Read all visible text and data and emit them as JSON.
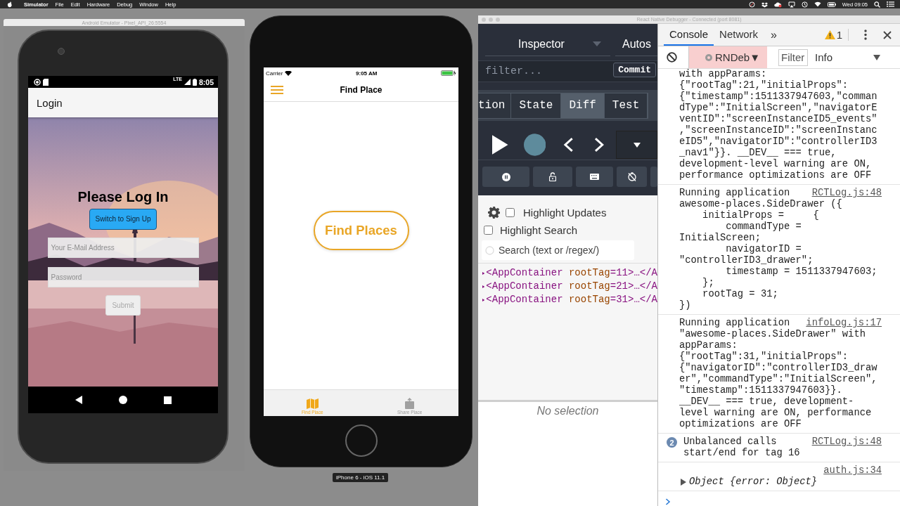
{
  "menu_bar": {
    "app_name": "Simulator",
    "menus": [
      "File",
      "Edit",
      "Hardware",
      "Debug",
      "Window",
      "Help"
    ],
    "clock": "Wed 09:05"
  },
  "android_emulator": {
    "window_title": "Android Emulator - Pixel_API_26:5554",
    "status_bar": {
      "network": "LTE",
      "time": "8:05"
    },
    "app_bar_title": "Login",
    "heading": "Please Log In",
    "switch_button": "Switch to Sign Up",
    "email_field": {
      "placeholder": "Your E-Mail Address"
    },
    "password_field": {
      "placeholder": "Password"
    },
    "submit": {
      "label": "Submit",
      "disabled": true
    }
  },
  "ios_simulator": {
    "status_bar": {
      "carrier": "Carrier",
      "time": "9:05 AM"
    },
    "nav_title": "Find Place",
    "find_places_button": "Find Places",
    "tabs": [
      {
        "label": "Find Place",
        "kind": "map",
        "selected": true
      },
      {
        "label": "Share Place",
        "kind": "share",
        "selected": false
      }
    ],
    "device_label": "iPhone 6 - iOS 11.1"
  },
  "debugger": {
    "window_title": "React Native Debugger - Connected (port 8081)",
    "redux": {
      "monitor": "Inspector",
      "second_monitor": "Autos",
      "filter_field": {
        "placeholder": "filter..."
      },
      "commit_button": "Commit",
      "tabs": [
        {
          "label": "tion",
          "selected": false
        },
        {
          "label": "State",
          "selected": false
        },
        {
          "label": "Diff",
          "selected": true
        },
        {
          "label": "Test",
          "selected": false
        }
      ]
    },
    "react": {
      "highlight_updates": {
        "label": "Highlight Updates",
        "checked": false
      },
      "highlight_search": {
        "label": "Highlight Search",
        "checked": false
      },
      "search_field": {
        "placeholder": "Search (text or /regex/)"
      },
      "tree": [
        {
          "tag": "<AppContainer",
          "attribute": " rootTag",
          "rest": "=11>…</A"
        },
        {
          "tag": "<AppContainer",
          "attribute": " rootTag",
          "rest": "=21>…</A"
        },
        {
          "tag": "<AppContainer",
          "attribute": " rootTag",
          "rest": "=31>…</A"
        }
      ],
      "details_placeholder": "No selection"
    },
    "console": {
      "tabs": [
        {
          "label": "Console",
          "selected": true
        },
        {
          "label": "Network",
          "selected": false
        }
      ],
      "more_tabs": "»",
      "warning_count": "1",
      "context": "RNDeb▼",
      "filter_field": {
        "placeholder": "Filter"
      },
      "level": "Info",
      "messages": [
        {
          "kind": "log",
          "text": "with appParams:\n{\"rootTag\":21,\"initialProps\":\n{\"timestamp\":1511337947603,\"comman\ndType\":\"InitialScreen\",\"navigatorE\nventID\":\"screenInstanceID5_events\"\n,\"screenInstanceID\":\"screenInstanc\neID5\",\"navigatorID\":\"controllerID3\n_nav1\"}}. __DEV__ === true,\ndevelopment-level warning are ON,\nperformance optimizations are OFF"
        },
        {
          "kind": "log",
          "source": "RCTLog.js:48",
          "text": "Running application\nawesome-places.SideDrawer ({\n    initialProps =     {\n        commandType =\nInitialScreen;\n        navigatorID =\n\"controllerID3_drawer\";\n        timestamp = 1511337947603;\n    };\n    rootTag = 31;\n})"
        },
        {
          "kind": "log",
          "source": "infoLog.js:17",
          "text": "Running application\n\"awesome-places.SideDrawer\" with\nappParams:\n{\"rootTag\":31,\"initialProps\":\n{\"navigatorID\":\"controllerID3_draw\ner\",\"commandType\":\"InitialScreen\",\n\"timestamp\":1511337947603}}.\n__DEV__ === true, development-\nlevel warning are ON, performance\noptimizations are OFF"
        },
        {
          "kind": "log",
          "count": "2",
          "source": "RCTLog.js:48",
          "text": "Unbalanced calls\nstart/end for tag 16"
        },
        {
          "kind": "object",
          "source": "auth.js:34",
          "text": "Object {error: Object}"
        }
      ]
    }
  }
}
